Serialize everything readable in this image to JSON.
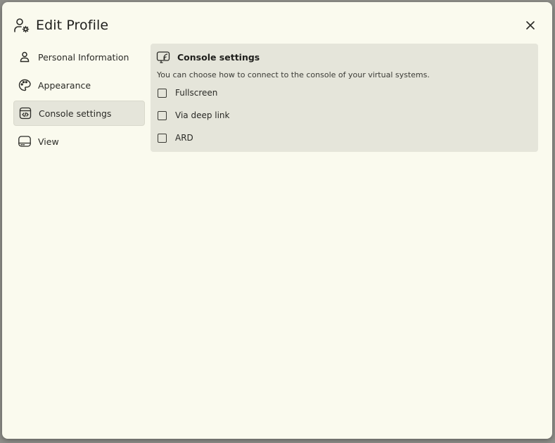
{
  "dialog": {
    "title": "Edit Profile",
    "title_icon": "user-gear-icon",
    "close_icon": "close-icon"
  },
  "sidebar": {
    "items": [
      {
        "label": "Personal Information",
        "icon": "person-icon",
        "active": false
      },
      {
        "label": "Appearance",
        "icon": "palette-icon",
        "active": false
      },
      {
        "label": "Console settings",
        "icon": "code-window-icon",
        "active": true
      },
      {
        "label": "View",
        "icon": "monitor-icon",
        "active": false
      }
    ]
  },
  "panel": {
    "title": "Console settings",
    "icon": "cast-screen-icon",
    "description": "You can choose how to connect to the console of your virtual systems.",
    "options": [
      {
        "label": "Fullscreen",
        "checked": false
      },
      {
        "label": "Via deep link",
        "checked": false
      },
      {
        "label": "ARD",
        "checked": false
      }
    ]
  },
  "colors": {
    "surface": "#fafaee",
    "panel": "#e5e5da",
    "text": "#1f1f1c"
  }
}
